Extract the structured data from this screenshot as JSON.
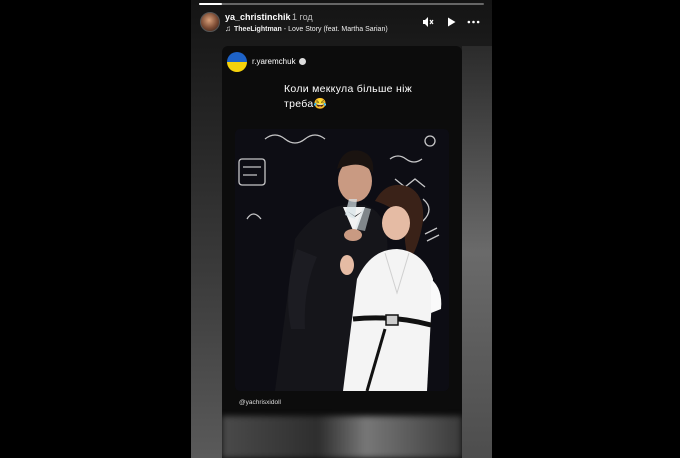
{
  "story": {
    "username": "ya_christinchik",
    "time": "1 год",
    "music": {
      "artist": "TheeLightman",
      "title": " - Love Story (feat. Martha Sarian)"
    },
    "progress": 0.08
  },
  "card": {
    "author": "r.yaremchuk",
    "caption": "Коли меккула більше ніж треба😂",
    "mention": "@yachrisxidoll"
  },
  "controls": [
    "mute-icon",
    "play-icon",
    "more-icon"
  ],
  "colors": {
    "accent_blue": "#1e63c8",
    "accent_yellow": "#f5d20c"
  }
}
